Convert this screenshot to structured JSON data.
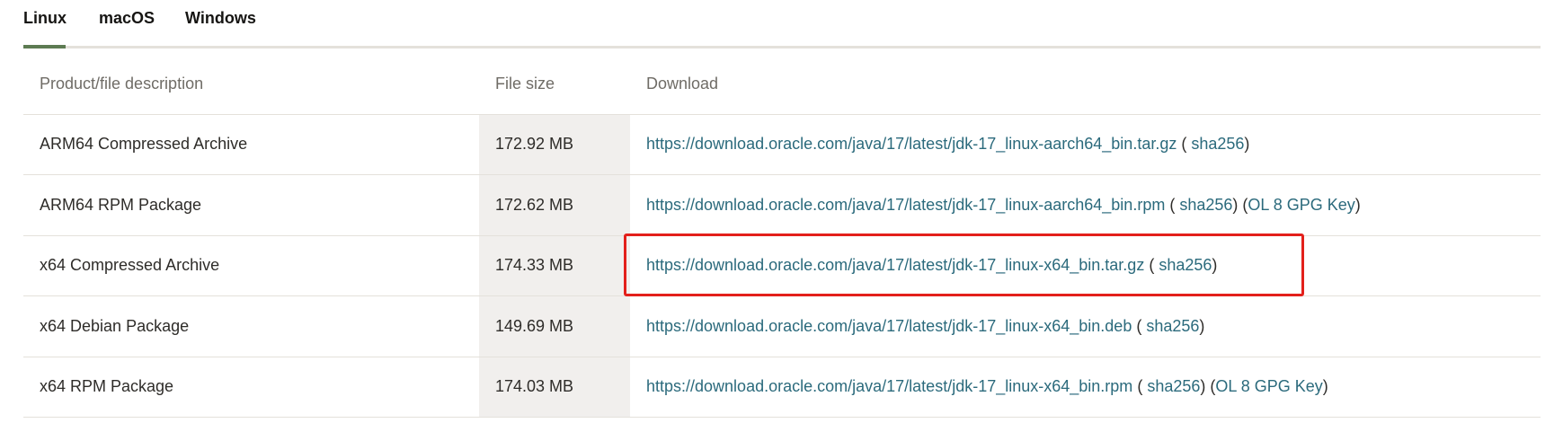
{
  "tabs": [
    {
      "label": "Linux",
      "active": true
    },
    {
      "label": "macOS",
      "active": false
    },
    {
      "label": "Windows",
      "active": false
    }
  ],
  "table": {
    "headers": {
      "description": "Product/file description",
      "file_size": "File size",
      "download": "Download"
    },
    "rows": [
      {
        "description": "ARM64 Compressed Archive",
        "file_size": "172.92 MB",
        "url": "https://download.oracle.com/java/17/latest/jdk-17_linux-aarch64_bin.tar.gz",
        "checksum": "sha256"
      },
      {
        "description": "ARM64 RPM Package",
        "file_size": "172.62 MB",
        "url": "https://download.oracle.com/java/17/latest/jdk-17_linux-aarch64_bin.rpm",
        "checksum": "sha256",
        "gpg_key": "OL 8 GPG Key"
      },
      {
        "description": "x64 Compressed Archive",
        "file_size": "174.33 MB",
        "url": "https://download.oracle.com/java/17/latest/jdk-17_linux-x64_bin.tar.gz",
        "checksum": "sha256"
      },
      {
        "description": "x64 Debian Package",
        "file_size": "149.69 MB",
        "url": "https://download.oracle.com/java/17/latest/jdk-17_linux-x64_bin.deb",
        "checksum": "sha256"
      },
      {
        "description": "x64 RPM Package",
        "file_size": "174.03 MB",
        "url": "https://download.oracle.com/java/17/latest/jdk-17_linux-x64_bin.rpm",
        "checksum": "sha256",
        "gpg_key": "OL 8 GPG Key"
      }
    ]
  },
  "colors": {
    "link": "#2b6a7c",
    "active_tab_underline": "#5d7b52",
    "highlight_box": "#e3201b",
    "size_cell_background": "#f1efed"
  }
}
